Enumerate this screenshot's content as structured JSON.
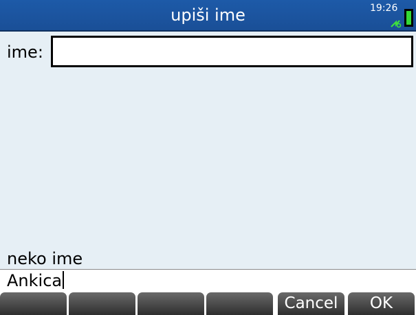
{
  "titlebar": {
    "title": "upiši ime",
    "clock": "19:26"
  },
  "form": {
    "field_label": "ime:",
    "field_value": ""
  },
  "help_text": "neko ime",
  "edit_line": {
    "value": "Ankica"
  },
  "menu": {
    "keys": [
      "",
      "",
      "",
      "",
      "Cancel",
      "OK"
    ]
  },
  "colors": {
    "titlebar": "#1a4f97",
    "background": "#e6eff5",
    "softkey": "#3e3e3e",
    "battery": "#35d935"
  }
}
